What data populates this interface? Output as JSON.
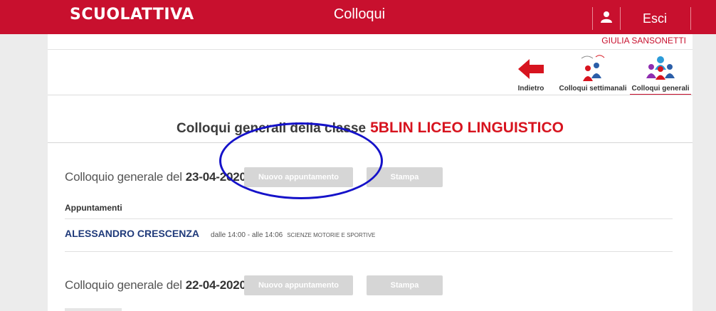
{
  "header": {
    "logo": "SCUOLATTIVA",
    "title": "Colloqui",
    "logout_label": "Esci",
    "user_icon": "user-icon"
  },
  "user": {
    "name": "GIULIA SANSONETTI"
  },
  "toolbar": {
    "back_label": "Indietro",
    "weekly_label": "Colloqui settimanali",
    "general_label": "Colloqui generali"
  },
  "section": {
    "title_prefix": "Colloqui generali della classe",
    "class_name": "5BLIN LICEO LINGUISTICO"
  },
  "colloqui": [
    {
      "label": "Colloquio generale del",
      "date": "23-04-2020",
      "new_button": "Nuovo appuntamento",
      "print_button": "Stampa",
      "appointments_header": "Appuntamenti",
      "appointments": [
        {
          "name": "ALESSANDRO CRESCENZA",
          "time": "dalle 14:00 - alle 14:06",
          "subject": "SCIENZE MOTORIE E SPORTIVE"
        }
      ]
    },
    {
      "label": "Colloquio generale del",
      "date": "22-04-2020",
      "new_button": "Nuovo appuntamento",
      "print_button": "Stampa"
    }
  ],
  "colors": {
    "brand_red": "#c8102e",
    "class_red": "#d7141f",
    "teacher_blue": "#1f3a7a",
    "annotation_blue": "#1512c9",
    "button_gray": "#d6d6d6"
  }
}
